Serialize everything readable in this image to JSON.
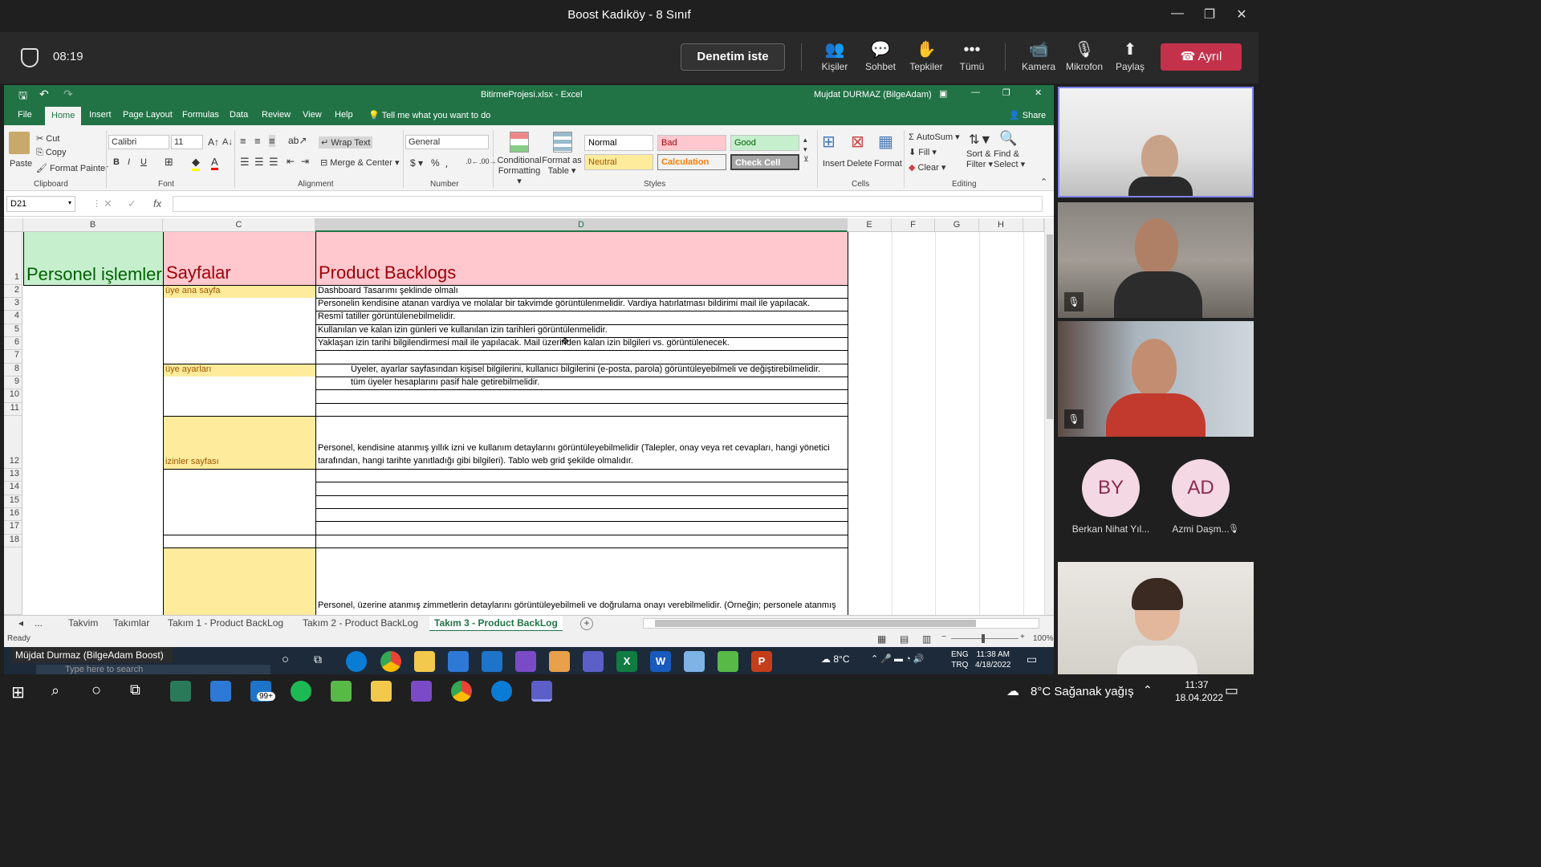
{
  "teams": {
    "window_title": "Boost Kadıköy - 8 Sınıf",
    "timer": "08:19",
    "request_control": "Denetim iste",
    "buttons": [
      {
        "label": "Kişiler",
        "icon": "people-icon"
      },
      {
        "label": "Sohbet",
        "icon": "chat-icon"
      },
      {
        "label": "Tepkiler",
        "icon": "reactions-icon"
      },
      {
        "label": "Tümü",
        "icon": "more-icon"
      },
      {
        "label": "Kamera",
        "icon": "camera-icon"
      },
      {
        "label": "Mikrofon",
        "icon": "mic-off-icon"
      },
      {
        "label": "Paylaş",
        "icon": "share-icon"
      }
    ],
    "leave_label": "Ayrıl",
    "presenter_label": "Müjdat Durmaz (BilgeAdam Boost)",
    "participants": [
      {
        "initials": "BY",
        "name": "Berkan Nihat Yıl..."
      },
      {
        "initials": "AD",
        "name": "Azmi Daşm..."
      }
    ]
  },
  "excel": {
    "title": "BitirmeProjesi.xlsx  -  Excel",
    "user": "Mujdat DURMAZ (BilgeAdam)",
    "menu": [
      "File",
      "Home",
      "Insert",
      "Page Layout",
      "Formulas",
      "Data",
      "Review",
      "View",
      "Help"
    ],
    "tell_me": "Tell me what you want to do",
    "share": "Share",
    "ribbon": {
      "paste": "Paste",
      "cut": "Cut",
      "copy": "Copy",
      "format_painter": "Format Painter",
      "clipboard": "Clipboard",
      "font_name": "Calibri",
      "font_size": "11",
      "font": "Font",
      "wrap_text": "Wrap Text",
      "merge_center": "Merge & Center",
      "alignment": "Alignment",
      "number_format": "General",
      "number": "Number",
      "conditional_formatting": [
        "Conditional",
        "Formatting"
      ],
      "format_as_table": [
        "Format as",
        "Table"
      ],
      "styles_label": "Styles",
      "styles": [
        {
          "label": "Normal"
        },
        {
          "label": "Bad"
        },
        {
          "label": "Good"
        },
        {
          "label": "Neutral"
        },
        {
          "label": "Calculation"
        },
        {
          "label": "Check Cell"
        }
      ],
      "insert": "Insert",
      "delete": "Delete",
      "format": "Format",
      "cells": "Cells",
      "autosum": "AutoSum",
      "fill": "Fill",
      "clear": "Clear",
      "sort_filter": [
        "Sort &",
        "Filter"
      ],
      "find_select": [
        "Find &",
        "Select"
      ],
      "editing": "Editing"
    },
    "name_box": "D21",
    "columns": [
      "B",
      "C",
      "D",
      "E",
      "F",
      "G",
      "H"
    ],
    "rows": [
      "1",
      "2",
      "3",
      "4",
      "5",
      "6",
      "7",
      "8",
      "9",
      "10",
      "11",
      "12",
      "13",
      "14",
      "15",
      "16",
      "17",
      "18"
    ],
    "header_cells": {
      "b1": "Personel işlemleri",
      "c1": "Sayfalar",
      "d1": "Product Backlogs"
    },
    "pages": {
      "c2": "üye ana sayfa",
      "c8": "üye ayarları",
      "c12": "izinler sayfası"
    },
    "backlog": {
      "d2": "Dashboard Tasarımı şeklinde olmalı",
      "d3": "Personelin kendisine atanan vardiya ve molalar bir takvimde görüntülenmelidir. Vardiya hatırlatması bildirimi mail ile yapılacak.",
      "d4": "Resmî tatiller görüntülenebilmelidir.",
      "d5": "Kullanılan ve kalan izin günleri ve kullanılan izin tarihleri görüntülenmelidir.",
      "d6": "Yaklaşan izin tarihi bilgilendirmesi mail ile yapılacak. Mail üzerinden kalan izin bilgileri vs. görüntülenecek.",
      "d8": "Üyeler, ayarlar sayfasından kişisel bilgilerini, kullanıcı bilgilerini (e-posta, parola) görüntüleyebilmeli ve değiştirebilmelidir.",
      "d9": "tüm üyeler hesaplarını pasif hale getirebilmelidir.",
      "d12a": "Personel, kendisine atanmış yıllık izni ve kullanım detaylarını görüntüleyebilmelidir (Talepler, onay veya ret cevapları, hangi yönetici",
      "d12b": "tarafından, hangi tarihte yanıtladığı gibi bilgileri). Tablo web grid şekilde olmalıdır.",
      "d19": "Personel, üzerine atanmış zimmetlerin detaylarını görüntüleyebilmeli ve doğrulama onayı verebilmelidir. (Örneğin; personele atanmış"
    },
    "sheet_tabs": [
      "...",
      "Takvim",
      "Takımlar",
      "Takım 1  - Product BackLog",
      "Takım 2  - Product BackLog",
      "Takım 3  - Product BackLog"
    ],
    "status": "Ready",
    "zoom": "100%"
  },
  "remote_taskbar": {
    "search": "Type here to search",
    "weather": "8°C",
    "lang": [
      "ENG",
      "TRQ"
    ],
    "time": "11:38 AM",
    "date": "4/18/2022"
  },
  "taskbar": {
    "mail_badge": "99+",
    "weather": "8°C  Sağanak yağış",
    "time": "11:37",
    "date": "18.04.2022"
  }
}
